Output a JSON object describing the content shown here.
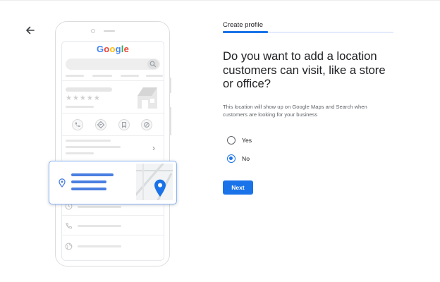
{
  "header": {
    "back_icon": "arrow-back-icon"
  },
  "illustration": {
    "logo_letters": [
      {
        "char": "G",
        "color": "#4285f4"
      },
      {
        "char": "o",
        "color": "#ea4335"
      },
      {
        "char": "o",
        "color": "#fbbc05"
      },
      {
        "char": "g",
        "color": "#4285f4"
      },
      {
        "char": "l",
        "color": "#34a853"
      },
      {
        "char": "e",
        "color": "#ea4335"
      }
    ],
    "stars": "★★★★★",
    "chevron": "›",
    "icons": [
      "search-icon",
      "store-icon",
      "phone-icon",
      "directions-icon",
      "bookmark-icon",
      "share-icon",
      "location-pin-icon",
      "map-pin-icon",
      "clock-icon",
      "globe-icon"
    ]
  },
  "form": {
    "tab_label": "Create profile",
    "question": "Do you want to add a location customers can visit, like a store or office?",
    "helper": "This location will show up on Google Maps and Search when customers are looking for your business",
    "options": [
      {
        "label": "Yes",
        "checked": false
      },
      {
        "label": "No",
        "checked": true
      }
    ],
    "next_label": "Next"
  },
  "colors": {
    "accent": "#1a73e8",
    "illustration_blue": "#4a7ee0",
    "tab_track": "#e3ebfb"
  }
}
